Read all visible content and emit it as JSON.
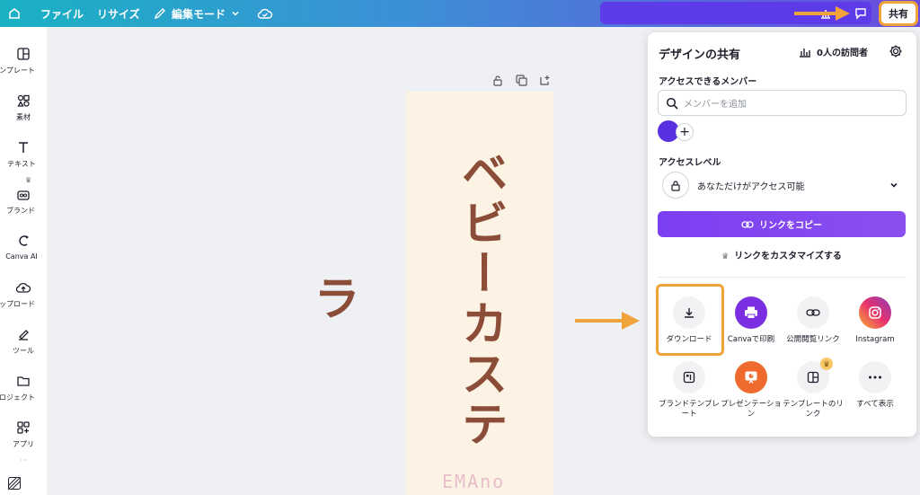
{
  "topbar": {
    "file_label": "ファイル",
    "resize_label": "リサイズ",
    "edit_mode_label": "編集モード",
    "share_label": "共有"
  },
  "sidebar": {
    "items": [
      {
        "label": "ンプレート",
        "icon": "template-icon"
      },
      {
        "label": "素材",
        "icon": "elements-icon"
      },
      {
        "label": "テキスト",
        "icon": "text-icon"
      },
      {
        "label": "ブランド",
        "icon": "brand-icon"
      },
      {
        "label": "Canva AI",
        "icon": "canva-ai-icon"
      },
      {
        "label": "ップロード",
        "icon": "upload-icon"
      },
      {
        "label": "ツール",
        "icon": "tools-icon"
      },
      {
        "label": "ロジェクト",
        "icon": "projects-icon"
      },
      {
        "label": "アプリ",
        "icon": "apps-icon"
      }
    ]
  },
  "canvas": {
    "vertical_text": "ベビーカステラ",
    "signature": "EMAno"
  },
  "share_panel": {
    "title": "デザインの共有",
    "visitors": "0人の訪問者",
    "members_heading": "アクセスできるメンバー",
    "member_placeholder": "メンバーを追加",
    "access_level_heading": "アクセスレベル",
    "access_level_value": "あなただけがアクセス可能",
    "copy_link_label": "リンクをコピー",
    "customize_link_label": "リンクをカスタマイズする",
    "options": [
      {
        "label": "ダウンロード",
        "icon": "download-icon"
      },
      {
        "label": "Canvaで印刷",
        "icon": "print-icon"
      },
      {
        "label": "公開閲覧リンク",
        "icon": "link-icon"
      },
      {
        "label": "Instagram",
        "icon": "instagram-icon"
      },
      {
        "label": "ブランドテンプレート",
        "icon": "brand-template-icon"
      },
      {
        "label": "プレゼンテーション",
        "icon": "presentation-icon"
      },
      {
        "label": "テンプレートのリンク",
        "icon": "template-link-icon"
      },
      {
        "label": "すべて表示",
        "icon": "more-icon"
      }
    ]
  },
  "colors": {
    "accent_purple": "#7b3ff2",
    "highlight_orange": "#f0a33a",
    "text_brown": "#8b4c38"
  }
}
